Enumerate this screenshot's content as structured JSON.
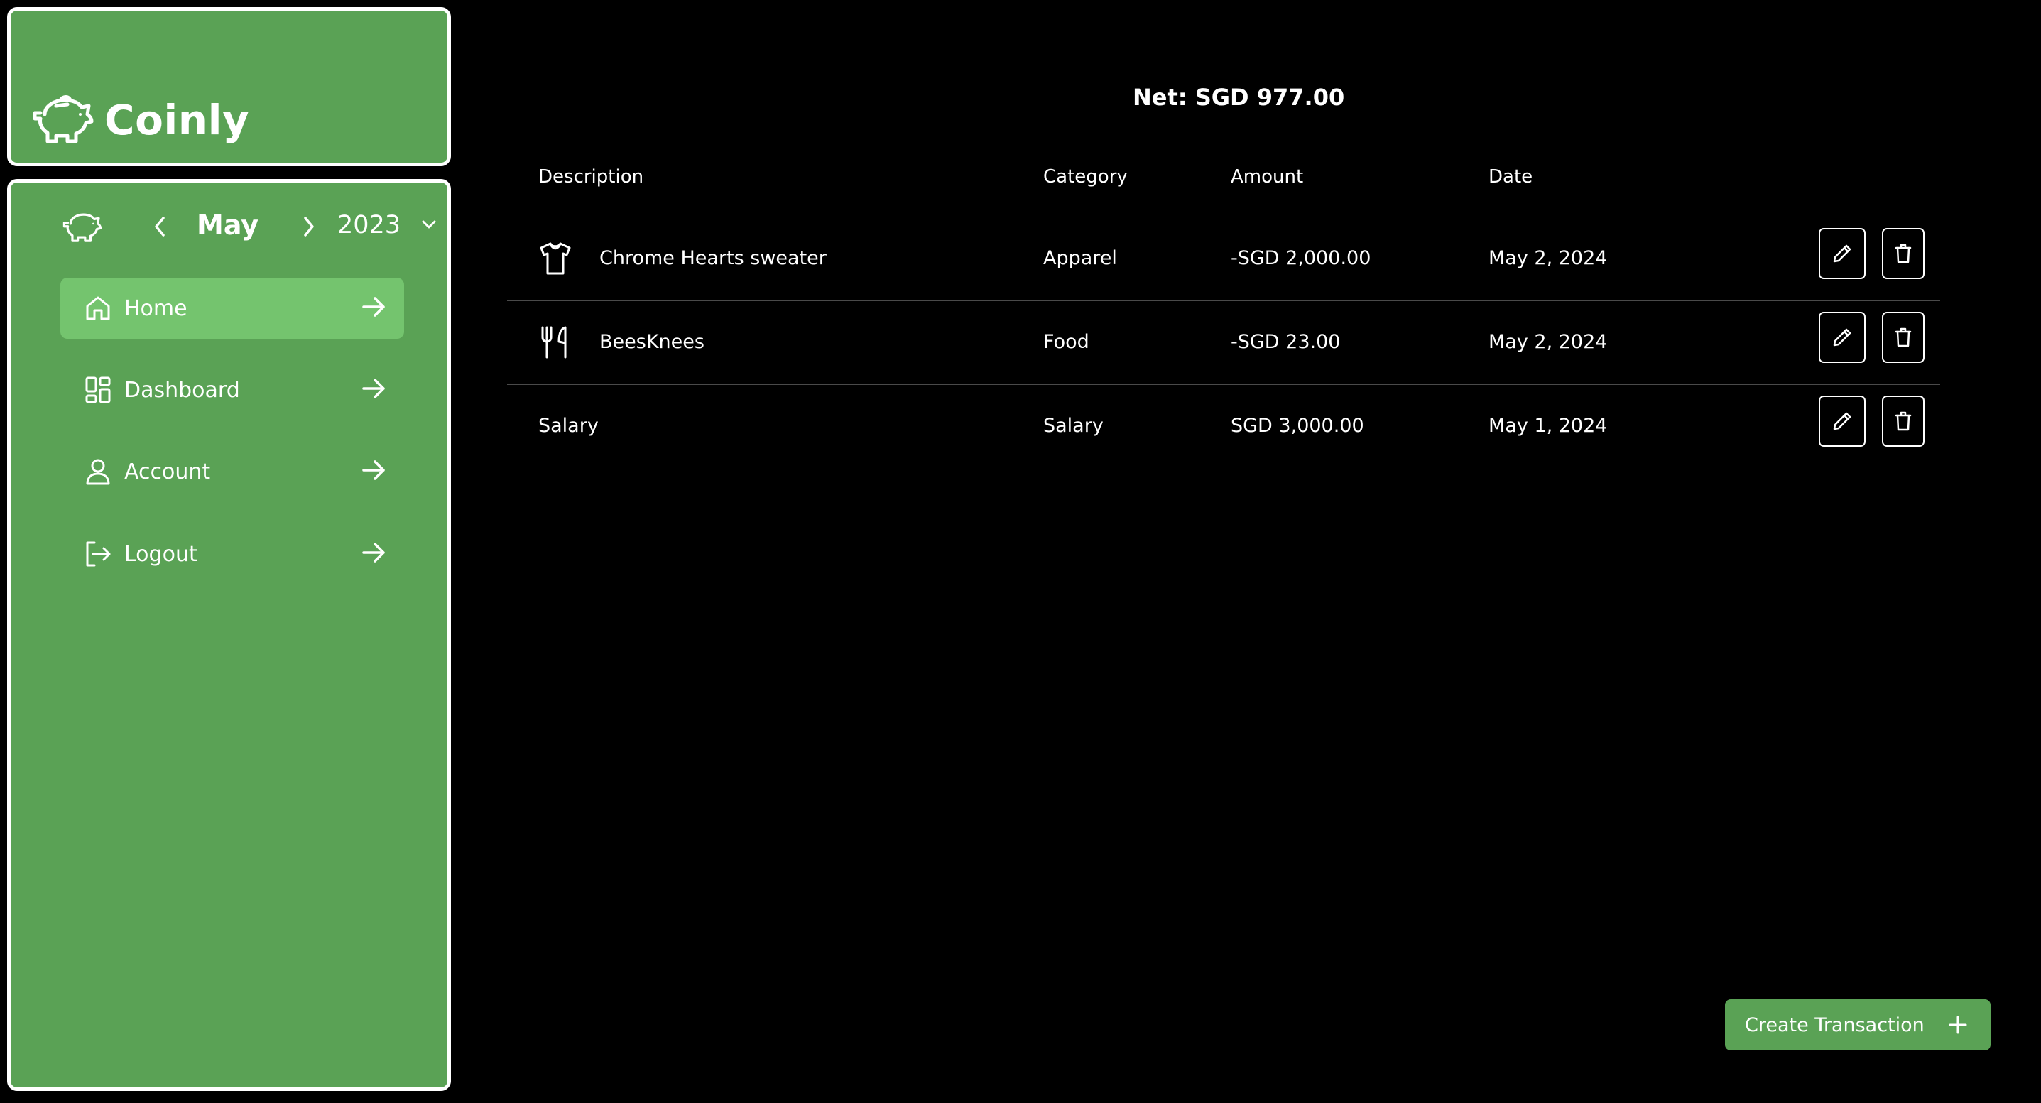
{
  "app": {
    "name": "Coinly",
    "logo_icon": "piggy-bank-icon"
  },
  "period": {
    "month": "May",
    "year": "2023"
  },
  "nav": {
    "items": [
      {
        "label": "Home",
        "icon": "home-icon",
        "active": true
      },
      {
        "label": "Dashboard",
        "icon": "dashboard-grid-icon",
        "active": false
      },
      {
        "label": "Account",
        "icon": "user-icon",
        "active": false
      },
      {
        "label": "Logout",
        "icon": "logout-icon",
        "active": false
      }
    ]
  },
  "summary": {
    "net": "Net: SGD 977.00"
  },
  "table": {
    "headers": {
      "description": "Description",
      "category": "Category",
      "amount": "Amount",
      "date": "Date"
    },
    "rows": [
      {
        "icon": "shirt-icon",
        "description": "Chrome Hearts sweater",
        "category": "Apparel",
        "amount": "-SGD 2,000.00",
        "date": "May 2, 2024"
      },
      {
        "icon": "utensils-icon",
        "description": "BeesKnees",
        "category": "Food",
        "amount": "-SGD 23.00",
        "date": "May 2, 2024"
      },
      {
        "icon": "",
        "description": "Salary",
        "category": "Salary",
        "amount": "SGD 3,000.00",
        "date": "May 1, 2024"
      }
    ]
  },
  "actions": {
    "create_label": "Create Transaction"
  },
  "colors": {
    "accent": "#5aa255",
    "accent_active": "#74c46e",
    "background": "#000000",
    "text": "#ffffff"
  }
}
